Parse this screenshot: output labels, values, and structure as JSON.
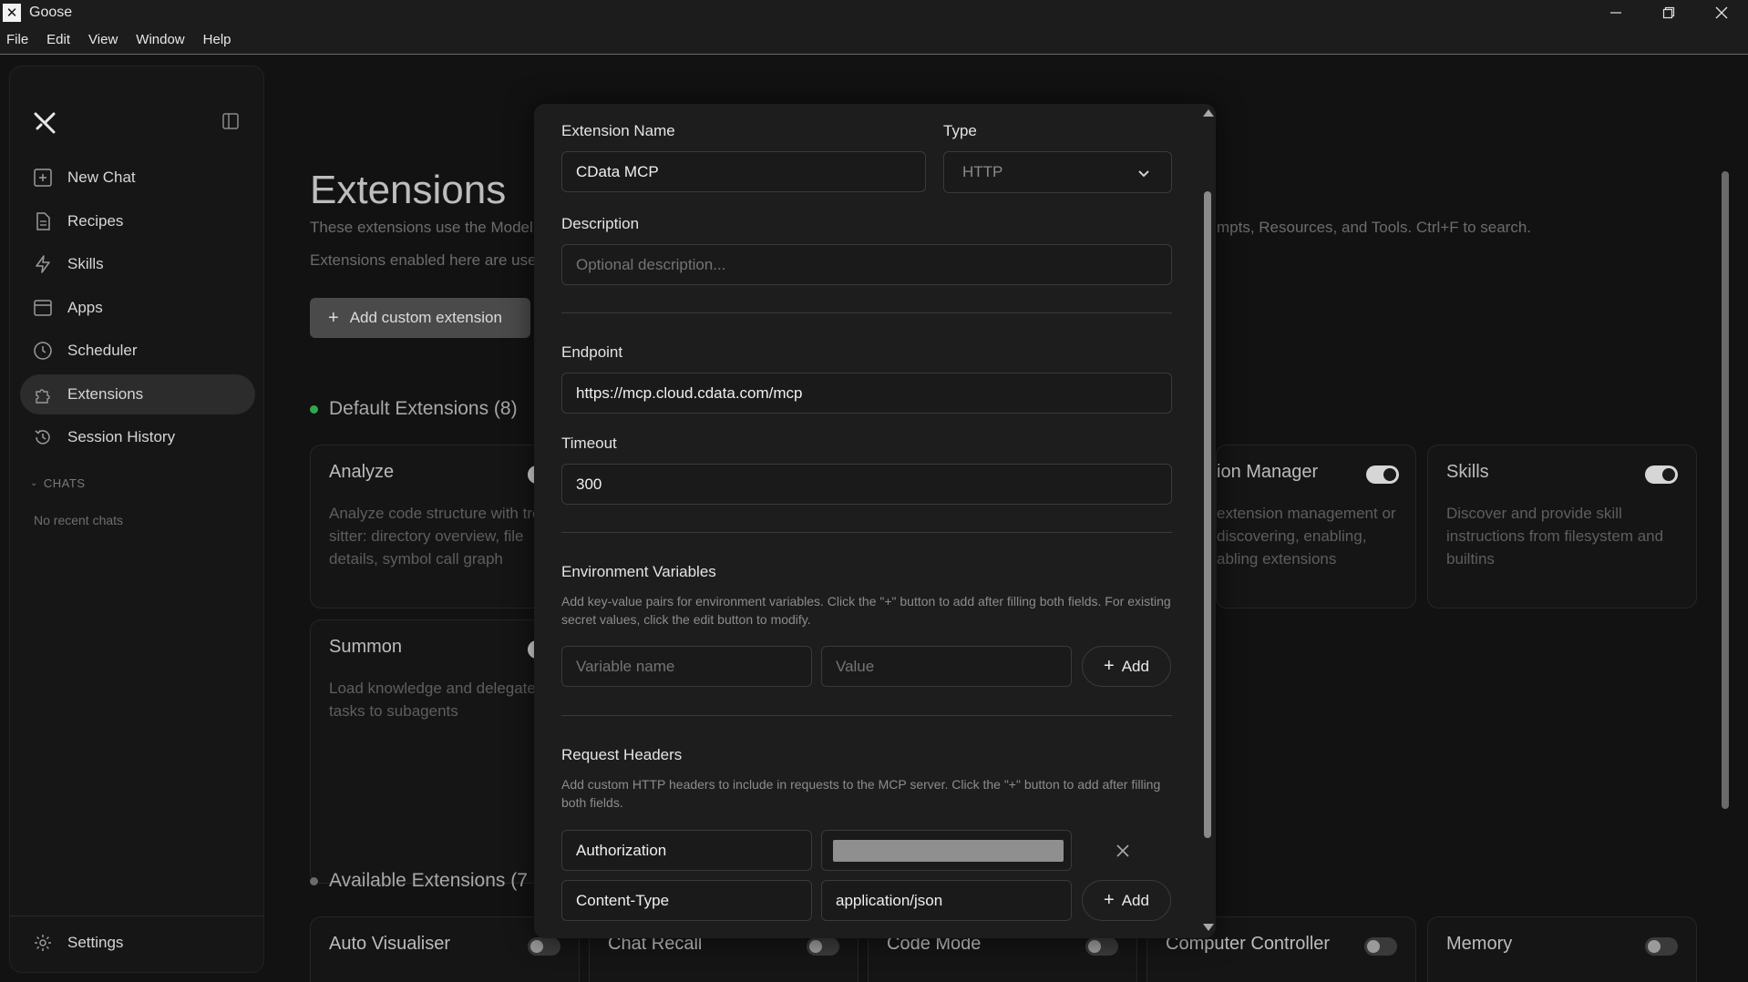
{
  "window": {
    "title": "Goose"
  },
  "menu": [
    "File",
    "Edit",
    "View",
    "Window",
    "Help"
  ],
  "sidebar": {
    "items": [
      {
        "label": "New Chat",
        "icon": "new-chat-icon"
      },
      {
        "label": "Recipes",
        "icon": "file-icon"
      },
      {
        "label": "Skills",
        "icon": "bolt-icon"
      },
      {
        "label": "Apps",
        "icon": "window-icon"
      },
      {
        "label": "Scheduler",
        "icon": "clock-icon"
      },
      {
        "label": "Extensions",
        "icon": "puzzle-icon",
        "active": true
      },
      {
        "label": "Session History",
        "icon": "history-icon"
      }
    ],
    "chats_heading": "CHATS",
    "no_chats": "No recent chats",
    "settings_label": "Settings"
  },
  "page": {
    "title": "Extensions",
    "subtitle_left": "These extensions use the Model",
    "subtitle_right": "mpts, Resources, and Tools. Ctrl+F to search.",
    "subtitle2": "Extensions enabled here are use",
    "add_custom_label": "Add custom extension",
    "default_section": "Default Extensions (8)",
    "available_section": "Available Extensions (7",
    "default_cards": [
      {
        "title": "Analyze",
        "desc": "Analyze code structure with tree-sitter: directory overview, file details, symbol call graph",
        "enabled": true
      },
      {
        "title": "Summon",
        "desc": "Load knowledge and delegate tasks to subagents",
        "enabled": true
      },
      {
        "title": "ion Manager",
        "desc": "extension management or discovering, enabling, abling extensions",
        "enabled": true
      },
      {
        "title": "Skills",
        "desc": "Discover and provide skill instructions from filesystem and builtins",
        "enabled": true
      }
    ],
    "available_cards": [
      {
        "title": "Auto Visualiser",
        "enabled": false
      },
      {
        "title": "Chat Recall",
        "enabled": false
      },
      {
        "title": "Code Mode",
        "enabled": false
      },
      {
        "title": "Computer Controller",
        "enabled": false
      },
      {
        "title": "Memory",
        "enabled": false
      }
    ],
    "colors": {
      "default_dot": "#2faa4a",
      "available_dot": "#6a6a6a"
    }
  },
  "modal": {
    "name_label": "Extension Name",
    "name_value": "CData MCP",
    "type_label": "Type",
    "type_value": "HTTP",
    "description_label": "Description",
    "description_placeholder": "Optional description...",
    "endpoint_label": "Endpoint",
    "endpoint_value": "https://mcp.cloud.cdata.com/mcp",
    "timeout_label": "Timeout",
    "timeout_value": "300",
    "env_label": "Environment Variables",
    "env_help": "Add key-value pairs for environment variables. Click the \"+\" button to add after filling both fields. For existing secret values, click the edit button to modify.",
    "env_name_placeholder": "Variable name",
    "env_value_placeholder": "Value",
    "add_label": "Add",
    "headers_label": "Request Headers",
    "headers_help": "Add custom HTTP headers to include in requests to the MCP server. Click the \"+\" button to add after filling both fields.",
    "header_rows": [
      {
        "name": "Authorization",
        "value_masked": true
      },
      {
        "name": "Content-Type",
        "value": "application/json"
      }
    ]
  }
}
